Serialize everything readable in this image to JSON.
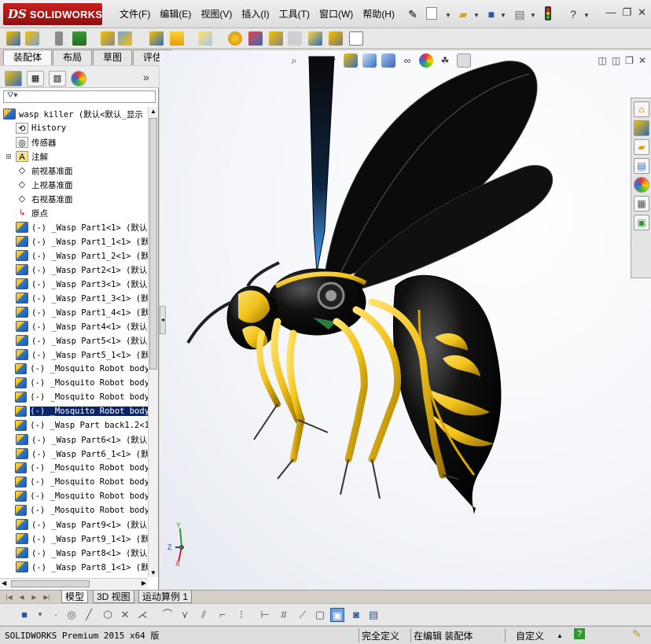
{
  "app": {
    "logo_ds": "DS",
    "logo_word": "SOLIDWORKS"
  },
  "menu": [
    "文件(F)",
    "编辑(E)",
    "视图(V)",
    "插入(I)",
    "工具(T)",
    "窗口(W)",
    "帮助(H)"
  ],
  "tabs": [
    "装配体",
    "布局",
    "草图",
    "评估"
  ],
  "tree": {
    "root": "wasp killer  (默认<默认_显示",
    "items": [
      {
        "label": "History",
        "icon": "history-icon",
        "expander": ""
      },
      {
        "label": "传感器",
        "icon": "sensor-icon",
        "expander": ""
      },
      {
        "label": "注解",
        "icon": "annotation-icon",
        "expander": "⊞"
      },
      {
        "label": "前视基准面",
        "icon": "plane-icon",
        "expander": ""
      },
      {
        "label": "上视基准面",
        "icon": "plane-icon",
        "expander": ""
      },
      {
        "label": "右视基准面",
        "icon": "plane-icon",
        "expander": ""
      },
      {
        "label": "原点",
        "icon": "origin-icon",
        "expander": ""
      },
      {
        "label": "(-) _Wasp Part1<1> (默认",
        "icon": "part-icon",
        "expander": ""
      },
      {
        "label": "(-) _Wasp Part1_1<1> (默",
        "icon": "part-icon",
        "expander": ""
      },
      {
        "label": "(-) _Wasp Part1_2<1> (默",
        "icon": "part-icon",
        "expander": ""
      },
      {
        "label": "(-) _Wasp Part2<1> (默认",
        "icon": "part-icon",
        "expander": ""
      },
      {
        "label": "(-) _Wasp Part3<1> (默认",
        "icon": "part-icon",
        "expander": ""
      },
      {
        "label": "(-) _Wasp Part1_3<1> (默",
        "icon": "part-icon",
        "expander": ""
      },
      {
        "label": "(-) _Wasp Part1_4<1> (默",
        "icon": "part-icon",
        "expander": ""
      },
      {
        "label": "(-) _Wasp Part4<1> (默认",
        "icon": "part-icon",
        "expander": ""
      },
      {
        "label": "(-) _Wasp Part5<1> (默认",
        "icon": "part-icon",
        "expander": ""
      },
      {
        "label": "(-) _Wasp Part5_1<1> (默",
        "icon": "part-icon",
        "expander": ""
      },
      {
        "label": "(-) _Mosquito Robot body",
        "icon": "part-icon",
        "expander": ""
      },
      {
        "label": "(-) _Mosquito Robot body",
        "icon": "part-icon",
        "expander": ""
      },
      {
        "label": "(-) _Mosquito Robot body",
        "icon": "part-icon",
        "expander": ""
      },
      {
        "label": "(-) _Mosquito Robot body",
        "icon": "part-icon",
        "expander": "",
        "selected": true
      },
      {
        "label": "(-) _Wasp Part back1.2<1",
        "icon": "part-icon",
        "expander": ""
      },
      {
        "label": "(-) _Wasp Part6<1> (默认",
        "icon": "part-icon",
        "expander": ""
      },
      {
        "label": "(-) _Wasp Part6_1<1> (默",
        "icon": "part-icon",
        "expander": ""
      },
      {
        "label": "(-) _Mosquito Robot body",
        "icon": "part-icon",
        "expander": ""
      },
      {
        "label": "(-) _Mosquito Robot body",
        "icon": "part-icon",
        "expander": ""
      },
      {
        "label": "(-) _Mosquito Robot body",
        "icon": "part-icon",
        "expander": ""
      },
      {
        "label": "(-) _Mosquito Robot body",
        "icon": "part-icon",
        "expander": ""
      },
      {
        "label": "(-) _Wasp Part9<1> (默认",
        "icon": "part-icon",
        "expander": ""
      },
      {
        "label": "(-) _Wasp Part9_1<1> (默",
        "icon": "part-icon",
        "expander": ""
      },
      {
        "label": "(-) _Wasp Part8<1> (默认",
        "icon": "part-icon",
        "expander": ""
      },
      {
        "label": "(-) _Wasp Part8_1<1> (默",
        "icon": "part-icon",
        "expander": ""
      }
    ]
  },
  "bottom_tabs": [
    "模型",
    "3D 视图",
    "运动算例 1"
  ],
  "status": {
    "product": "SOLIDWORKS Premium 2015 x64 版",
    "defined": "完全定义",
    "editing": "在编辑 装配体",
    "units": "自定义"
  },
  "axis_labels": {
    "x": "X",
    "y": "Y",
    "z": "Z"
  },
  "colors": {
    "brand": "#c8201f",
    "selection": "#0a246a",
    "wasp_yellow": "#f2c21a",
    "wasp_black": "#0c0c0c"
  }
}
